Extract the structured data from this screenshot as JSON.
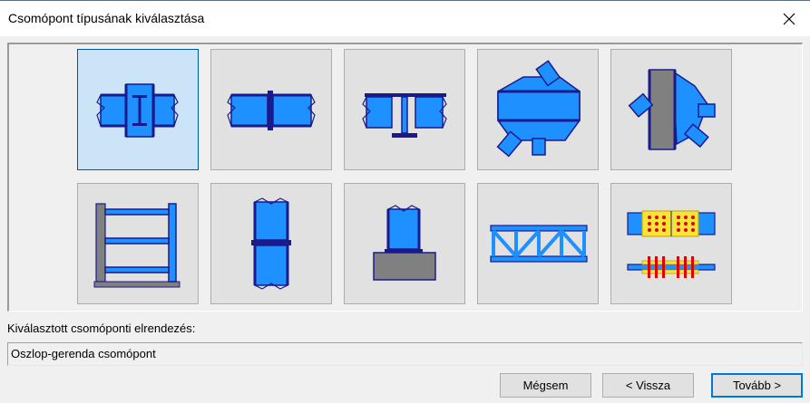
{
  "window": {
    "title": "Csomópont típusának kiválasztása"
  },
  "icons": {
    "close": "close-icon",
    "tiles": [
      "column-beam-joint-icon",
      "beam-splice-icon",
      "beam-to-beam-joint-icon",
      "truss-node-icon",
      "brace-gusset-joint-icon",
      "frame-base-icon",
      "column-splice-icon",
      "column-base-icon",
      "truss-icon",
      "bolted-plate-icon"
    ]
  },
  "selected_tile": 0,
  "colors": {
    "steel_fill": "#1e90ff",
    "steel_outline": "#1a1a8c",
    "concrete": "#808080",
    "plate_yellow": "#f5e536",
    "bolt_red": "#e00000",
    "selection": "#cce4f7",
    "selection_border": "#0055a0",
    "default_button_border": "#0078d7"
  },
  "selection": {
    "label": "Kiválasztott csomóponti elrendezés:",
    "value": "Oszlop-gerenda csomópont"
  },
  "buttons": {
    "cancel": "Mégsem",
    "back": "< Vissza",
    "next": "Tovább >"
  }
}
